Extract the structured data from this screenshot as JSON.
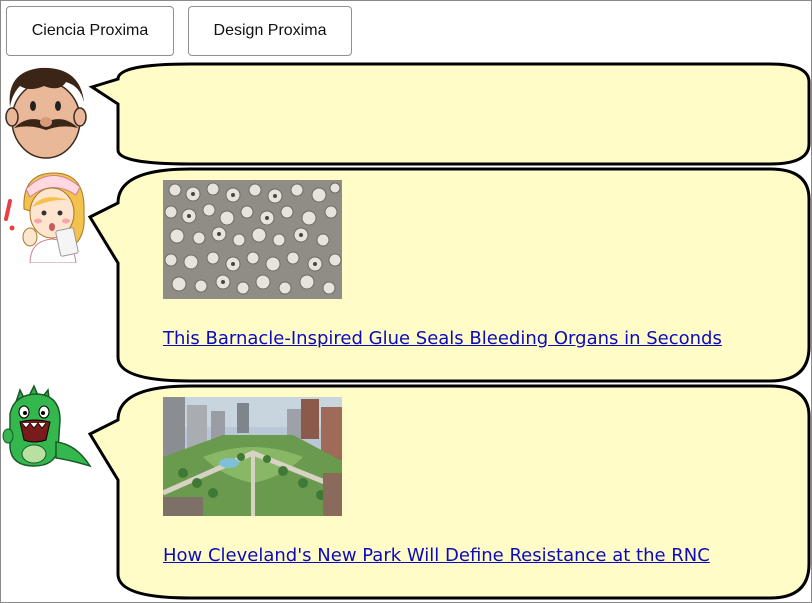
{
  "tabs": [
    {
      "label": "Ciencia Proxima"
    },
    {
      "label": "Design Proxima"
    }
  ],
  "messages": [
    {
      "avatar": "mustache-man-avatar",
      "headline": ""
    },
    {
      "avatar": "nurse-avatar",
      "headline": "This Barnacle-Inspired Glue Seals Bleeding Organs in Seconds"
    },
    {
      "avatar": "green-dinosaur-avatar",
      "headline": "How Cleveland's New Park Will Define Resistance at the RNC"
    }
  ],
  "colors": {
    "bubble_fill": "#fffcc8",
    "bubble_stroke": "#000000",
    "link": "#0b0bbd"
  }
}
